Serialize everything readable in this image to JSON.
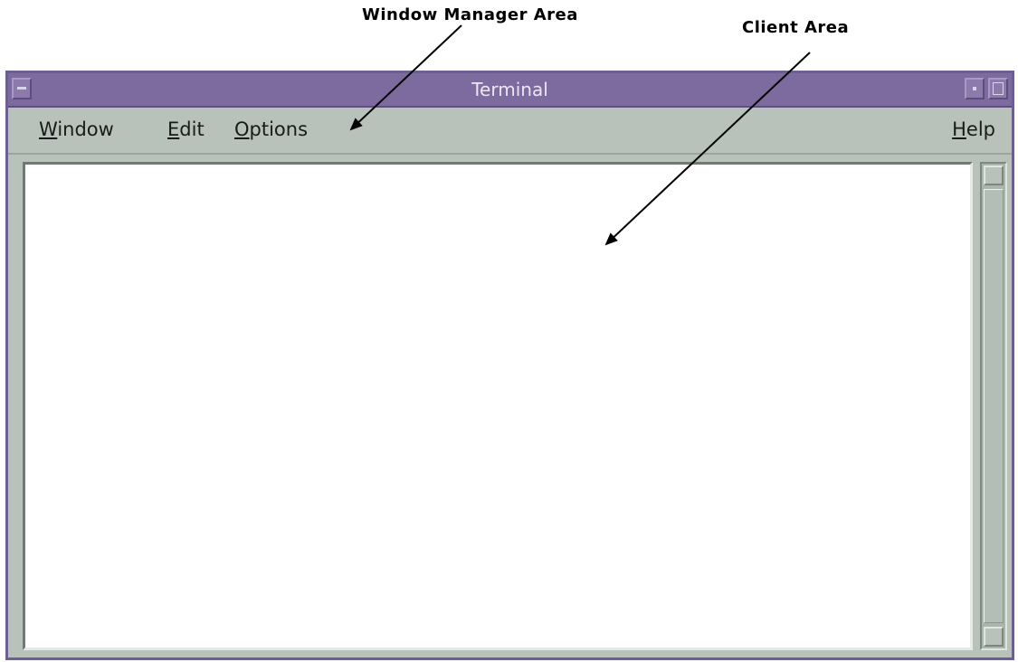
{
  "annotations": {
    "window_manager_area": "Window Manager Area",
    "client_area": "Client Area"
  },
  "window": {
    "title": "Terminal"
  },
  "menubar": {
    "window": {
      "mnemonic": "W",
      "rest": "indow"
    },
    "edit": {
      "mnemonic": "E",
      "rest": "dit"
    },
    "options": {
      "mnemonic": "O",
      "rest": "ptions"
    },
    "help": {
      "mnemonic": "H",
      "rest": "elp"
    }
  },
  "icons": {
    "window_menu": "window-menu-icon",
    "minimize": "minimize-icon",
    "maximize": "maximize-icon",
    "scroll_up": "scroll-up-arrow-icon",
    "scroll_down": "scroll-down-arrow-icon"
  },
  "colors": {
    "titlebar": "#7d6a9e",
    "frame": "#b8c2bb",
    "client": "#ffffff"
  }
}
